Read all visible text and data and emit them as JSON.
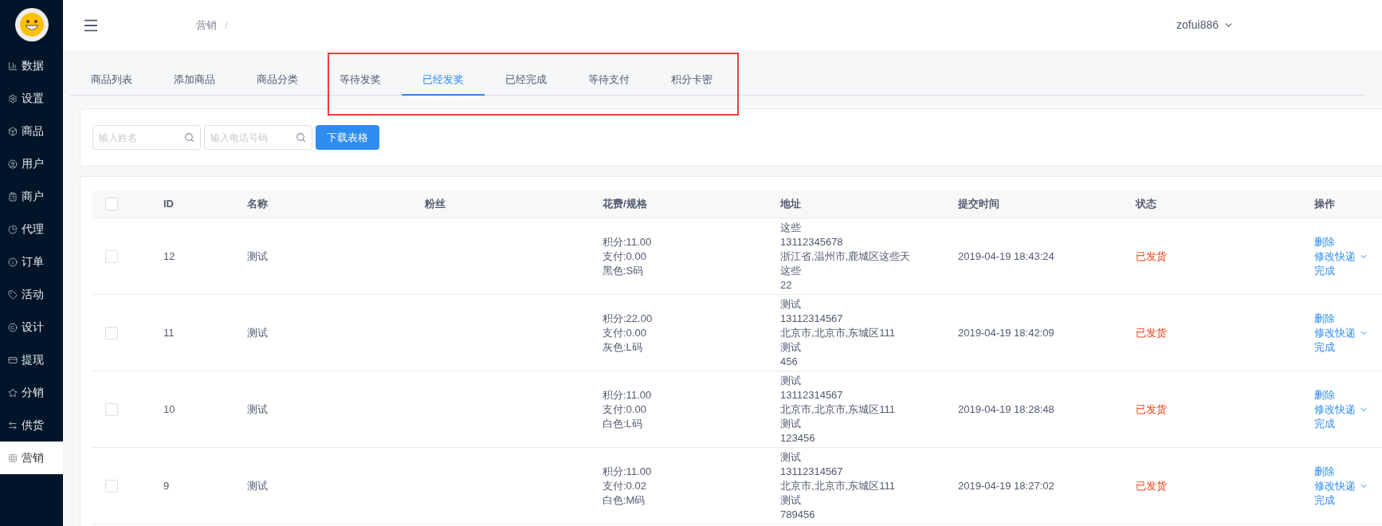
{
  "sidebar": {
    "items": [
      {
        "label": "数据",
        "selected": false
      },
      {
        "label": "设置",
        "selected": false
      },
      {
        "label": "商品",
        "selected": false
      },
      {
        "label": "用户",
        "selected": false
      },
      {
        "label": "商户",
        "selected": false
      },
      {
        "label": "代理",
        "selected": false
      },
      {
        "label": "订单",
        "selected": false
      },
      {
        "label": "活动",
        "selected": false
      },
      {
        "label": "设计",
        "selected": false
      },
      {
        "label": "提现",
        "selected": false
      },
      {
        "label": "分销",
        "selected": false
      },
      {
        "label": "供货",
        "selected": false
      },
      {
        "label": "营销",
        "selected": true
      }
    ]
  },
  "header": {
    "breadcrumb": [
      "营销",
      "/"
    ],
    "user": "zofui886"
  },
  "tabs": [
    {
      "label": "商品列表",
      "selected": false
    },
    {
      "label": "添加商品",
      "selected": false
    },
    {
      "label": "商品分类",
      "selected": false
    },
    {
      "label": "等待发奖",
      "selected": false
    },
    {
      "label": "已经发奖",
      "selected": true
    },
    {
      "label": "已经完成",
      "selected": false
    },
    {
      "label": "等待支付",
      "selected": false
    },
    {
      "label": "积分卡密",
      "selected": false
    }
  ],
  "filters": {
    "fields": [
      {
        "placeholder": "输入姓名"
      },
      {
        "placeholder": "输入电话号码"
      }
    ],
    "button": "下载表格"
  },
  "table": {
    "columns": [
      "ID",
      "名称",
      "粉丝",
      "花费/规格",
      "地址",
      "提交时间",
      "状态",
      "操作"
    ],
    "header_checked": false,
    "rows": [
      {
        "checked": false,
        "id": "12",
        "name": "测试",
        "cost": [
          "积分:11.00",
          "支付:0.00",
          "黑色:S码"
        ],
        "address": [
          "这些",
          "13112345678",
          "浙江省,温州市,鹿城区这些天",
          "这些",
          "22"
        ],
        "time": "2019-04-19 18:43:24",
        "status": "已发货",
        "actions": [
          "删除",
          "修改快递",
          "完成"
        ]
      },
      {
        "checked": false,
        "id": "11",
        "name": "测试",
        "cost": [
          "积分:22.00",
          "支付:0.00",
          "灰色:L码"
        ],
        "address": [
          "测试",
          "13112314567",
          "北京市,北京市,东城区111",
          "测试",
          "456"
        ],
        "time": "2019-04-19 18:42:09",
        "status": "已发货",
        "actions": [
          "删除",
          "修改快递",
          "完成"
        ]
      },
      {
        "checked": false,
        "id": "10",
        "name": "测试",
        "cost": [
          "积分:11.00",
          "支付:0.00",
          "白色:L码"
        ],
        "address": [
          "测试",
          "13112314567",
          "北京市,北京市,东城区111",
          "测试",
          "123456"
        ],
        "time": "2019-04-19 18:28:48",
        "status": "已发货",
        "actions": [
          "删除",
          "修改快递",
          "完成"
        ]
      },
      {
        "checked": false,
        "id": "9",
        "name": "测试",
        "cost": [
          "积分:11.00",
          "支付:0.02",
          "白色:M码"
        ],
        "address": [
          "测试",
          "13112314567",
          "北京市,北京市,东城区111",
          "测试",
          "789456"
        ],
        "time": "2019-04-19 18:27:02",
        "status": "已发货",
        "actions": [
          "删除",
          "修改快递",
          "完成"
        ]
      }
    ]
  }
}
